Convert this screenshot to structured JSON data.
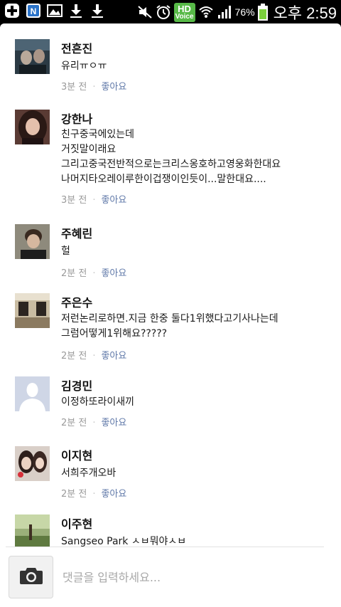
{
  "status_bar": {
    "icons": [
      "add-icon",
      "naver-app-icon",
      "gallery-icon",
      "download-icon",
      "download-icon",
      "mute-icon",
      "alarm-icon",
      "hd-voice-icon",
      "wifi-icon",
      "signal-icon",
      "battery-icon"
    ],
    "hd_top": "HD",
    "hd_bottom": "Voice",
    "battery_percent": "76%",
    "ampm": "오후",
    "time": "2:59"
  },
  "comments": [
    {
      "name": "전흔진",
      "text": "유리ㅠㅇㅠ",
      "time": "3분 전",
      "like": "좋아요",
      "avatar": "photo-dark"
    },
    {
      "name": "강한나",
      "text": "친구중국에있는데\n거짓말이래요\n그리고중국전반적으로는크리스옹호하고영웅화한대요\n나머지타오레이루한이겁쟁이인듯이...말한대요....",
      "time": "3분 전",
      "like": "좋아요",
      "avatar": "photo-girl"
    },
    {
      "name": "주혜린",
      "text": "헐",
      "time": "2분 전",
      "like": "좋아요",
      "avatar": "photo-boy"
    },
    {
      "name": "주은수",
      "text": "저런논리로하면.지금 한중 둘다1위했다고기사나는데\n그럼어떻게1위해요?????",
      "time": "2분 전",
      "like": "좋아요",
      "avatar": "photo-stage"
    },
    {
      "name": "김경민",
      "text": "이정하또라이새끼",
      "time": "2분 전",
      "like": "좋아요",
      "avatar": "default-avatar"
    },
    {
      "name": "이지현",
      "text": "서희주개오바",
      "time": "2분 전",
      "like": "좋아요",
      "avatar": "photo-couple"
    },
    {
      "name": "이주현",
      "text": "Sangseo Park ㅅㅂ뭐야ㅅㅂ",
      "time": "",
      "like": "",
      "avatar": "photo-park"
    }
  ],
  "input": {
    "placeholder": "댓글을 입력하세요..."
  }
}
